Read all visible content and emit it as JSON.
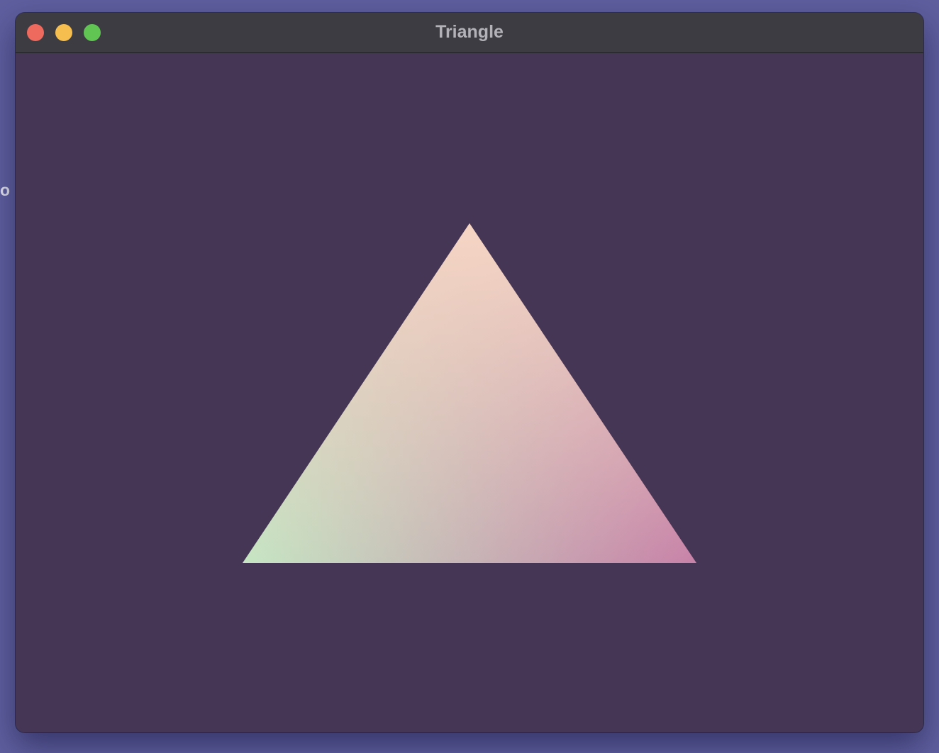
{
  "desktop": {
    "edge_glyph": "o",
    "background_color": "#5f5f9f"
  },
  "window": {
    "title": "Triangle",
    "controls": {
      "close_color": "#ee6a5e",
      "minimize_color": "#f5be4f",
      "zoom_color": "#61c554"
    }
  },
  "canvas": {
    "clear_color": "#463655",
    "triangle": {
      "top_vertex_color": "#f6d5c4",
      "left_vertex_color": "#c6e6c3",
      "right_vertex_color": "#c882a8"
    }
  }
}
